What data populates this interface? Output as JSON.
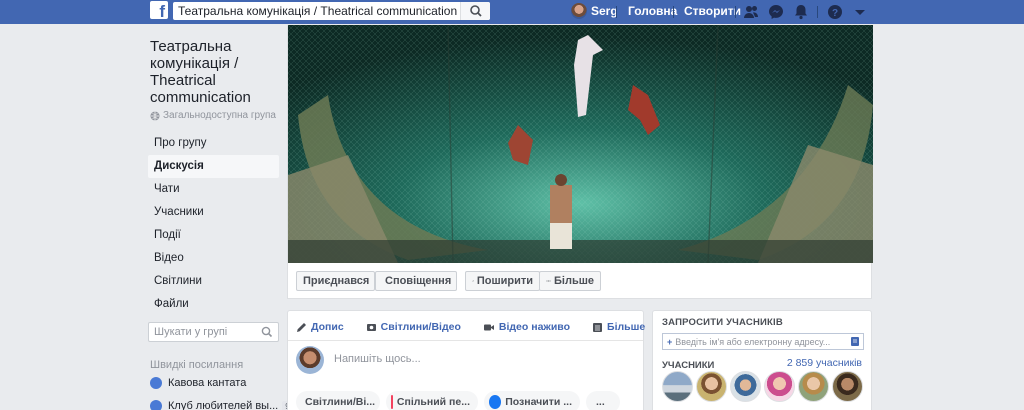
{
  "topbar": {
    "logo": "f",
    "search_value": "Театральна комунікація / Theatrical communication",
    "user_name": "Serg",
    "home_label": "Головна",
    "create_label": "Створити",
    "icons": [
      "friends-icon",
      "messenger-icon",
      "notifications-icon",
      "help-icon",
      "account-menu-icon"
    ]
  },
  "group": {
    "title": "Театральна комунікація / Theatrical communication",
    "type": "Загальнодоступна група"
  },
  "nav": {
    "items": [
      {
        "label": "Про групу",
        "active": false
      },
      {
        "label": "Дискусія",
        "active": true
      },
      {
        "label": "Чати",
        "active": false
      },
      {
        "label": "Учасники",
        "active": false
      },
      {
        "label": "Події",
        "active": false
      },
      {
        "label": "Відео",
        "active": false
      },
      {
        "label": "Світлини",
        "active": false
      },
      {
        "label": "Файли",
        "active": false
      }
    ]
  },
  "group_search": {
    "placeholder": "Шукати у групі"
  },
  "shortcuts": {
    "heading": "Швидкі посилання",
    "items": [
      {
        "label": "Кавова кантата",
        "badge": ""
      },
      {
        "label": "Клуб любителей вы...",
        "badge": "9"
      }
    ]
  },
  "actions": {
    "joined": "Приєднався",
    "notifications": "Сповіщення",
    "share": "Поширити",
    "more": "Більше"
  },
  "composer": {
    "tabs": [
      "Допис",
      "Світлини/Відео",
      "Відео наживо",
      "Більше"
    ],
    "placeholder": "Напишіть щось...",
    "pills": [
      "Світлини/Ві...",
      "Спільний пе...",
      "Позначити ...",
      "..."
    ]
  },
  "invite": {
    "heading": "ЗАПРОСИТИ УЧАСНИКІВ",
    "placeholder": "Введіть ім'я або електронну адресу...",
    "members_label": "УЧАСНИКИ",
    "members_count": "2 859 учасників"
  },
  "colors": {
    "brand": "#4267b2",
    "page_bg": "#e9ebee"
  }
}
